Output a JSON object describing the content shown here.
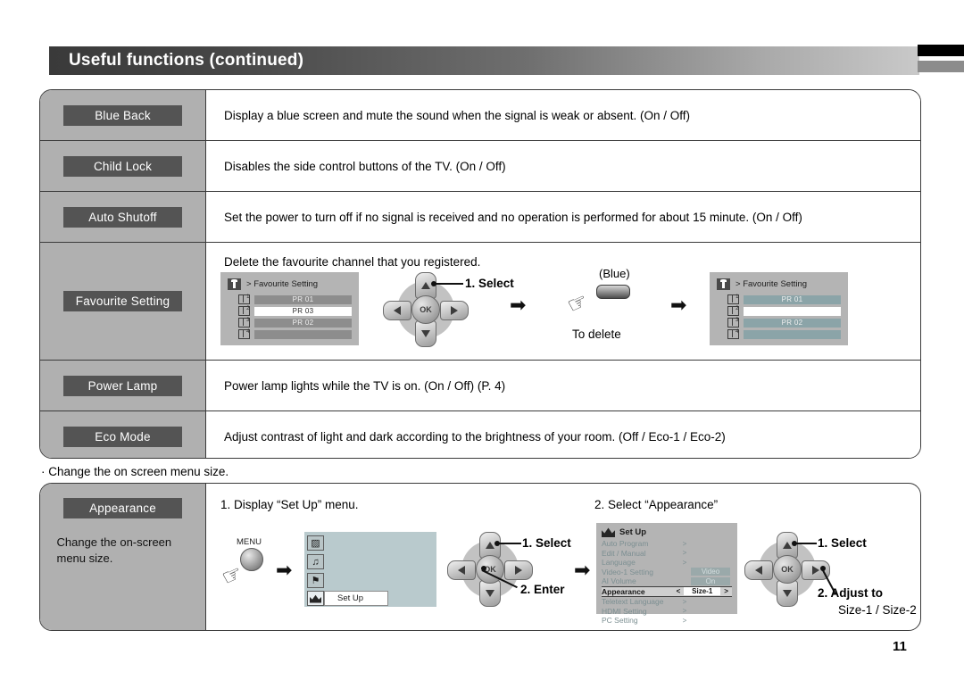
{
  "header": {
    "title": "Useful functions (continued)",
    "edge_tab_top_color": "#000000",
    "edge_tab_bottom_color": "#8c8c8c"
  },
  "functions_table": {
    "rows": [
      {
        "label": "Blue Back",
        "description": "Display a blue screen and mute the sound when the signal is weak or absent. (On / Off)"
      },
      {
        "label": "Child Lock",
        "description": "Disables the side control buttons of the TV. (On / Off)"
      },
      {
        "label": "Auto Shutoff",
        "description": "Set the power to turn off if no signal is received and no operation is performed for about 15 minute. (On / Off)"
      },
      {
        "label": "Favourite Setting",
        "description": "Delete the favourite channel that you registered."
      },
      {
        "label": "Power Lamp",
        "description": "Power lamp lights while the TV is on. (On / Off) (P. 4)"
      },
      {
        "label": "Eco Mode",
        "description": "Adjust contrast of light and dark according to the brightness of your room. (Off / Eco-1 / Eco-2)"
      }
    ]
  },
  "favourite_flow": {
    "osd_before": {
      "title": "Favourite Setting",
      "prefix": ">",
      "channels": [
        {
          "num": "1",
          "text": "PR 01",
          "highlighted": false
        },
        {
          "num": "2",
          "text": "PR 03",
          "highlighted": true
        },
        {
          "num": "3",
          "text": "PR 02",
          "highlighted": false
        },
        {
          "num": "4",
          "text": "",
          "highlighted": false
        }
      ]
    },
    "step_select": "1. Select",
    "ok_label": "OK",
    "blue_button_label": "(Blue)",
    "to_delete_label": "To delete",
    "arrow_glyph": "➡",
    "osd_after": {
      "title": "Favourite Setting",
      "prefix": ">",
      "channels": [
        {
          "num": "1",
          "text": "PR 01",
          "highlighted": false
        },
        {
          "num": "2",
          "text": "",
          "highlighted": true
        },
        {
          "num": "3",
          "text": "PR 02",
          "highlighted": false
        },
        {
          "num": "4",
          "text": "",
          "highlighted": false
        }
      ]
    }
  },
  "note": "· Change the on screen menu size.",
  "appearance_section": {
    "label": "Appearance",
    "sub_text": "Change the on-screen menu size.",
    "step1_title": "1. Display “Set Up” menu.",
    "menu_button_label": "MENU",
    "tv_menu": {
      "icons": [
        "picture-icon",
        "sound-icon",
        "feature-icon",
        "setup-icon"
      ],
      "tooltip": "Set Up"
    },
    "step1_dpad": {
      "select": "1. Select",
      "enter": "2. Enter",
      "ok_label": "OK"
    },
    "arrow_glyph": "➡",
    "step2_title": "2. Select “Appearance”",
    "setup_menu": {
      "title": "Set Up",
      "items": [
        {
          "name": "Auto Program",
          "arrow": ">",
          "value": null,
          "selected": false
        },
        {
          "name": "Edit / Manual",
          "arrow": ">",
          "value": null,
          "selected": false
        },
        {
          "name": "Language",
          "arrow": ">",
          "value": null,
          "selected": false
        },
        {
          "name": "Video-1 Setting",
          "arrow": "",
          "value": "Video",
          "selected": false
        },
        {
          "name": "AI Volume",
          "arrow": "",
          "value": "On",
          "selected": false
        },
        {
          "name": "Appearance",
          "arrow": "<",
          "value": "Size-1",
          "selected": true,
          "arrow_right": ">"
        },
        {
          "name": "Teletext Language",
          "arrow": ">",
          "value": null,
          "selected": false
        },
        {
          "name": "HDMI Setting",
          "arrow": ">",
          "value": null,
          "selected": false
        },
        {
          "name": "PC Setting",
          "arrow": ">",
          "value": null,
          "selected": false
        }
      ]
    },
    "step2_dpad": {
      "select": "1. Select",
      "adjust_line1": "2. Adjust to",
      "adjust_line2": "Size-1 / Size-2",
      "ok_label": "OK"
    }
  },
  "page_number": "11"
}
